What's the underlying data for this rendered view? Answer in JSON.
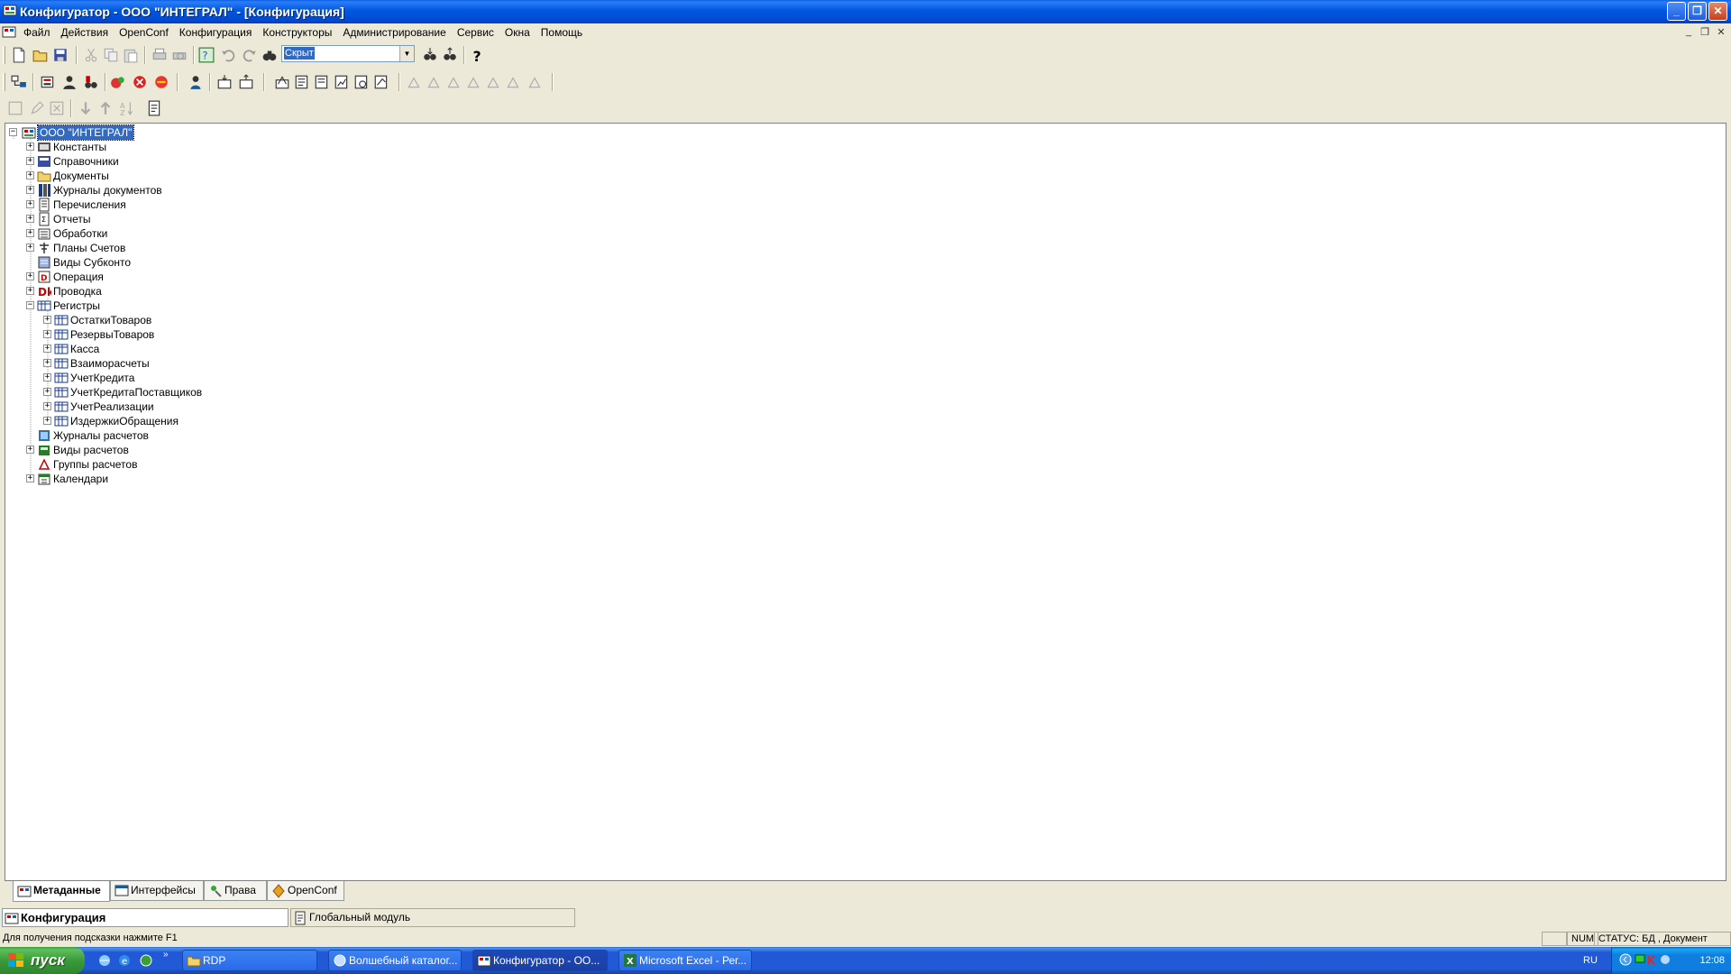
{
  "window": {
    "title": "Конфигуратор - ООО \"ИНТЕГРАЛ\" - [Конфигурация]"
  },
  "menu": [
    "Файл",
    "Действия",
    "OpenConf",
    "Конфигурация",
    "Конструкторы",
    "Администрирование",
    "Сервис",
    "Окна",
    "Помощь"
  ],
  "toolbar": {
    "search_combo_value": "Скрыт"
  },
  "tree": {
    "root": "ООО \"ИНТЕГРАЛ\"",
    "items": [
      {
        "label": "Константы",
        "icon": "constants-icon",
        "expand": "+"
      },
      {
        "label": "Справочники",
        "icon": "catalogs-icon",
        "expand": "+"
      },
      {
        "label": "Документы",
        "icon": "documents-folder-icon",
        "expand": "+"
      },
      {
        "label": "Журналы документов",
        "icon": "document-journals-icon",
        "expand": "+"
      },
      {
        "label": "Перечисления",
        "icon": "enumerations-icon",
        "expand": "+"
      },
      {
        "label": "Отчеты",
        "icon": "reports-icon",
        "expand": "+"
      },
      {
        "label": "Обработки",
        "icon": "data-processors-icon",
        "expand": "+"
      },
      {
        "label": "Планы Счетов",
        "icon": "chart-of-accounts-icon",
        "expand": "+"
      },
      {
        "label": "Виды Субконто",
        "icon": "subconto-types-icon",
        "expand": ""
      },
      {
        "label": "Операция",
        "icon": "operation-icon",
        "expand": "+"
      },
      {
        "label": "Проводка",
        "icon": "entry-icon",
        "expand": "+"
      },
      {
        "label": "Регистры",
        "icon": "registers-icon",
        "expand": "−"
      }
    ],
    "registers": [
      "ОстаткиТоваров",
      "РезервыТоваров",
      "Касса",
      "Взаиморасчеты",
      "УчетКредита",
      "УчетКредитаПоставщиков",
      "УчетРеализации",
      "ИздержкиОбращения"
    ],
    "after": [
      {
        "label": "Журналы расчетов",
        "icon": "calc-journals-icon",
        "expand": ""
      },
      {
        "label": "Виды расчетов",
        "icon": "calc-types-icon",
        "expand": "+"
      },
      {
        "label": "Группы расчетов",
        "icon": "calc-groups-icon",
        "expand": ""
      },
      {
        "label": "Календари",
        "icon": "calendars-icon",
        "expand": "+"
      }
    ]
  },
  "bottom_tabs": [
    "Метаданные",
    "Интерфейсы",
    "Права",
    "OpenConf"
  ],
  "windows": [
    "Конфигурация",
    "Глобальный модуль"
  ],
  "status": {
    "hint": "Для получения подсказки нажмите F1",
    "num": "NUM",
    "state": "СТАТУС: БД , Документ"
  },
  "taskbar": {
    "start": "пуск",
    "tasks": [
      "RDP",
      "Волшебный каталог...",
      "Конфигуратор - ОО...",
      "Microsoft Excel - Рег..."
    ],
    "lang": "RU",
    "clock": "12:08"
  },
  "colors": {
    "selection": "#316ac5",
    "titlebar": "#0054e3",
    "taskbar": "#245edb",
    "start": "#3c9c3c"
  }
}
